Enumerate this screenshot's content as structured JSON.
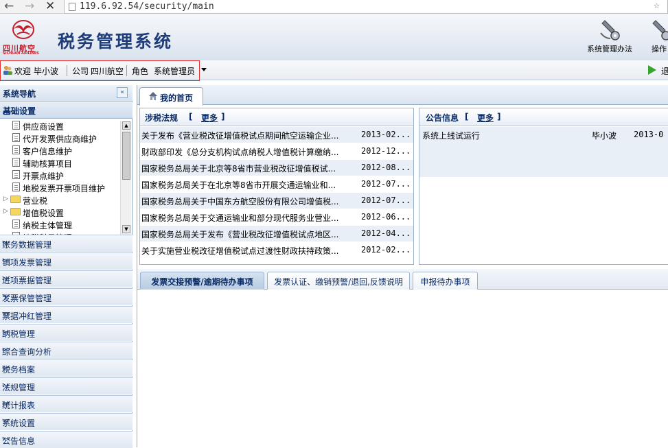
{
  "browser": {
    "back": "←",
    "forward": "→",
    "stop": "✕",
    "url": "119.6.92.54/security/main",
    "star": "☆"
  },
  "header": {
    "logo_cn": "四川航空",
    "logo_en": "SICHUAN AIRLINES",
    "title": "税务管理系统",
    "tools": [
      {
        "label": "系统管理办法",
        "icon": "settings-wrench-icon"
      },
      {
        "label": "操作",
        "icon": "operation-icon"
      }
    ]
  },
  "userbar": {
    "welcome_label": "欢迎",
    "welcome_name": "毕小波",
    "company_label": "公司",
    "company_value": "四川航空",
    "role_label": "角色",
    "role_value": "系统管理员",
    "exit_label": "退"
  },
  "sidebar": {
    "title": "系统导航",
    "collapse_glyph": "«",
    "active_group": "基础设置",
    "tree_items": [
      {
        "label": "供应商设置",
        "type": "doc"
      },
      {
        "label": "代开发票供应商维护",
        "type": "doc"
      },
      {
        "label": "客户信息维护",
        "type": "doc"
      },
      {
        "label": "辅助核算项目",
        "type": "doc"
      },
      {
        "label": "开票点维护",
        "type": "doc"
      },
      {
        "label": "地税发票开票项目维护",
        "type": "doc"
      },
      {
        "label": "营业税",
        "type": "folder"
      },
      {
        "label": "增值税设置",
        "type": "folder"
      },
      {
        "label": "纳税主体管理",
        "type": "doc"
      },
      {
        "label": "地税科目管理",
        "type": "doc"
      }
    ],
    "groups": [
      "账务数据管理",
      "销项发票管理",
      "进项票据管理",
      "发票保管管理",
      "票据冲红管理",
      "纳税管理",
      "综合查询分析",
      "税务档案",
      "法规管理",
      "统计报表",
      "系统设置",
      "公告信息"
    ]
  },
  "main": {
    "home_tab": "我的首页",
    "laws": {
      "title": "涉税法规",
      "bracket_open": "[",
      "more": "更多",
      "bracket_close": "]",
      "rows": [
        {
          "title": "关于发布《营业税改征增值税试点期间航空运输企业...",
          "date": "2013-02..."
        },
        {
          "title": "财政部印发《总分支机构试点纳税人增值税计算缴纳...",
          "date": "2012-12..."
        },
        {
          "title": "国家税务总局关于北京等8省市营业税改征增值税试...",
          "date": "2012-08..."
        },
        {
          "title": "国家税务总局关于在北京等8省市开展交通运输业和...",
          "date": "2012-07..."
        },
        {
          "title": "国家税务总局关于中国东方航空股份有限公司增值税...",
          "date": "2012-07..."
        },
        {
          "title": "国家税务总局关于交通运输业和部分现代服务业营业...",
          "date": "2012-06..."
        },
        {
          "title": "国家税务总局关于发布《营业税改征增值税试点地区...",
          "date": "2012-04..."
        },
        {
          "title": "关于实施营业税改征增值税试点过渡性财政扶持政策...",
          "date": "2012-02..."
        }
      ]
    },
    "notices": {
      "title": "公告信息",
      "bracket_open": "[",
      "more": "更多",
      "bracket_close": "]",
      "rows": [
        {
          "title": "系统上线试运行",
          "author": "毕小波",
          "date": "2013-0"
        }
      ]
    },
    "bottom_tabs": [
      "发票交接预警/逾期待办事项",
      "发票认证、缴销预警/退回,反馈说明",
      "申报待办事项"
    ]
  }
}
